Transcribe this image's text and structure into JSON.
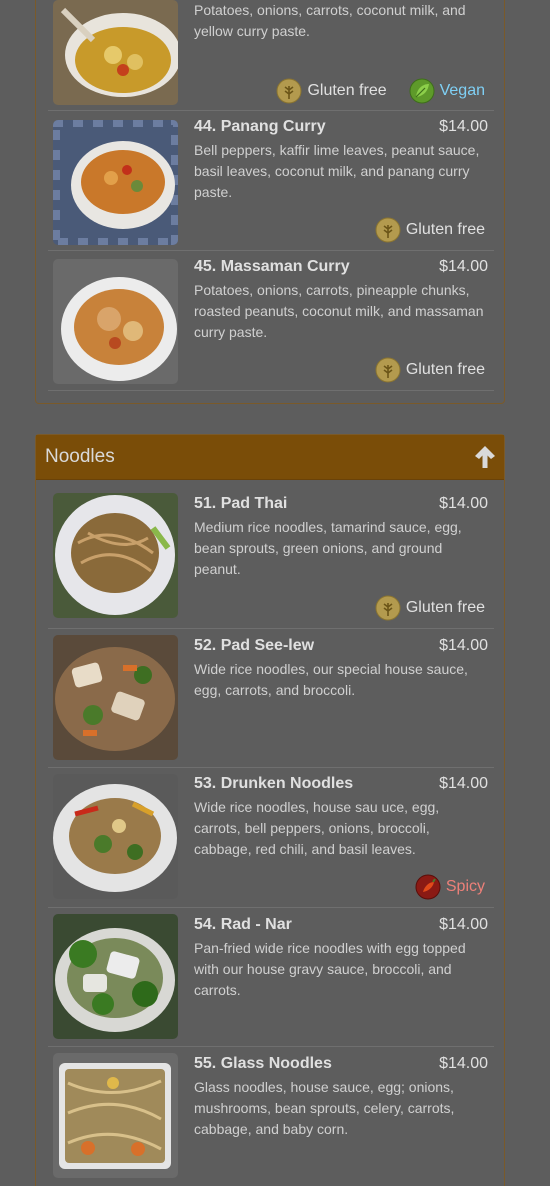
{
  "curry": {
    "items": [
      {
        "name": "",
        "price": "",
        "desc": "Potatoes, onions, carrots, coconut milk, and yellow curry paste.",
        "gluten": "Gluten free",
        "vegan": "Vegan"
      },
      {
        "name": "44. Panang Curry",
        "price": "$14.00",
        "desc": "Bell peppers, kaffir lime leaves, peanut sauce, basil leaves, coconut milk, and panang curry paste.",
        "gluten": "Gluten free"
      },
      {
        "name": "45. Massaman Curry",
        "price": "$14.00",
        "desc": "Potatoes, onions, carrots, pineapple chunks, roasted peanuts, coconut milk, and massaman curry paste.",
        "gluten": "Gluten free"
      }
    ]
  },
  "noodles": {
    "title": "Noodles",
    "items": [
      {
        "name": "51. Pad Thai",
        "price": "$14.00",
        "desc": "Medium rice noodles, tamarind sauce, egg, bean sprouts, green onions, and ground peanut.",
        "gluten": "Gluten free"
      },
      {
        "name": "52. Pad See-lew",
        "price": "$14.00",
        "desc": "Wide rice noodles, our special house sauce, egg, carrots, and broccoli."
      },
      {
        "name": "53. Drunken Noodles",
        "price": "$14.00",
        "desc": "Wide rice noodles, house sau uce, egg, carrots, bell peppers, onions, broccoli, cabbage, red chili, and basil leaves.",
        "spicy": "Spicy"
      },
      {
        "name": "54. Rad - Nar",
        "price": "$14.00",
        "desc": "Pan-fried wide rice noodles with egg topped with our house gravy sauce, broccoli, and carrots."
      },
      {
        "name": "55. Glass Noodles",
        "price": "$14.00",
        "desc": "Glass noodles, house sauce, egg; onions, mushrooms, bean sprouts, celery, carrots, cabbage, and baby corn."
      }
    ]
  },
  "colors": {
    "header": "#7a4d08",
    "vegan": "#7fd0f5",
    "spicy": "#ec8079"
  },
  "icons": [
    "gluten-free-wheat-icon",
    "vegan-leaf-icon",
    "spicy-chili-icon",
    "arrow-up-icon"
  ]
}
